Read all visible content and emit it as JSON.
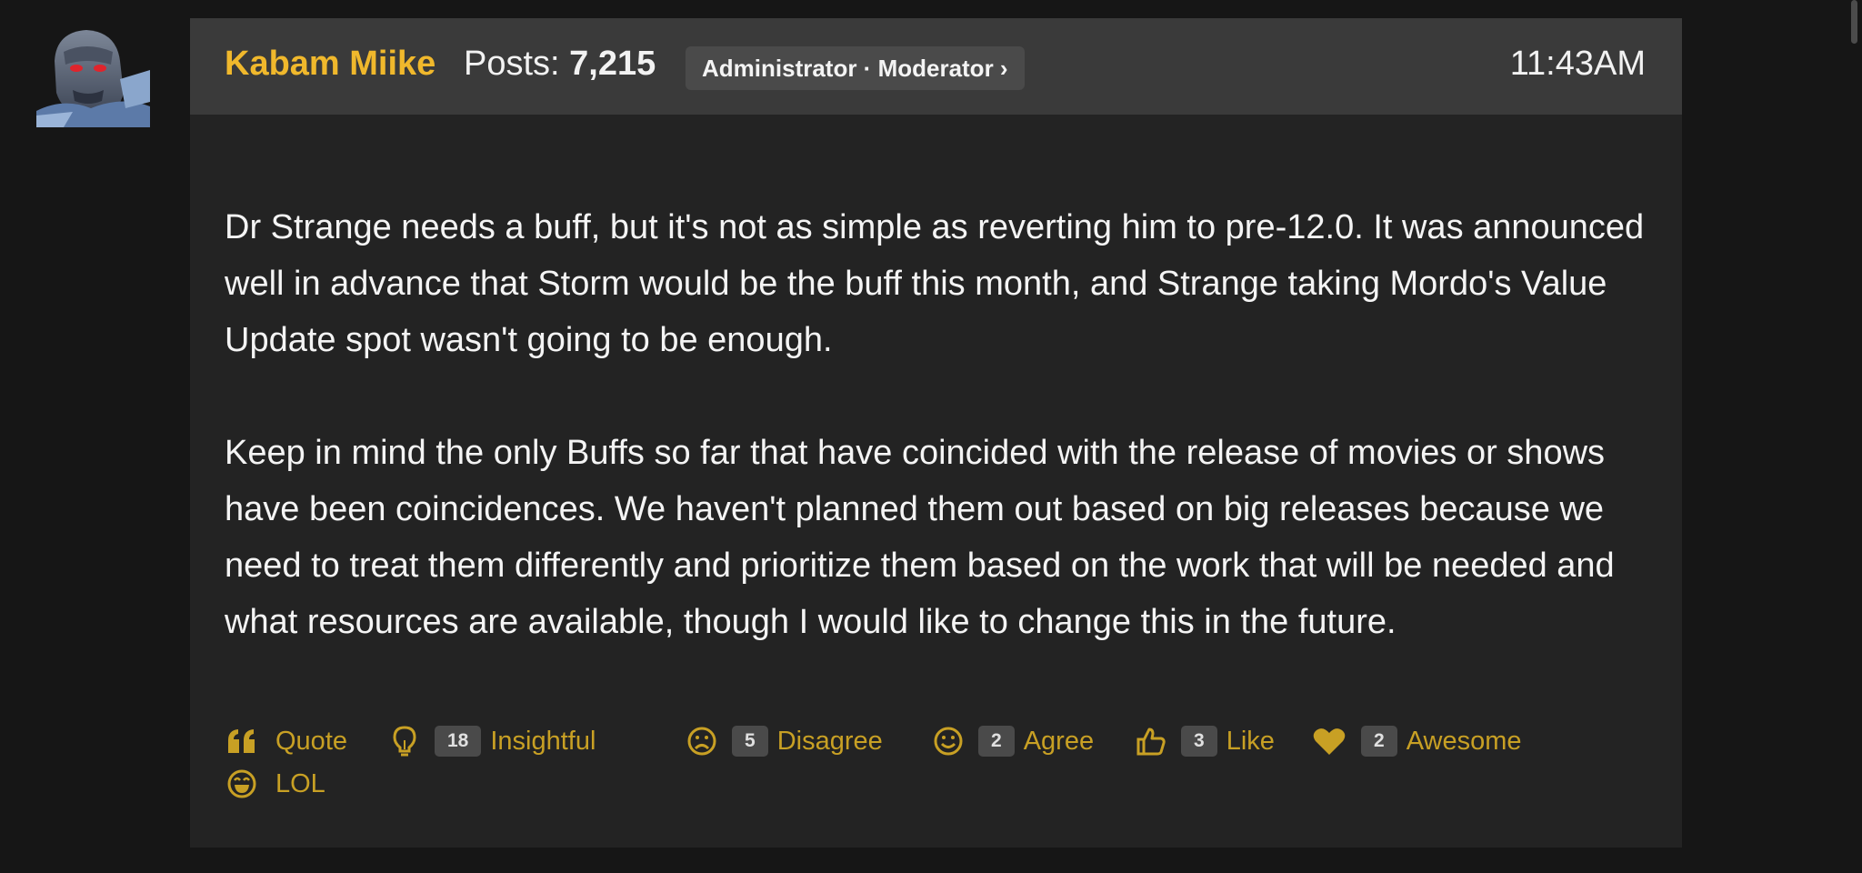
{
  "post": {
    "author": "Kabam Miike",
    "posts_label": "Posts: ",
    "posts_count": "7,215",
    "role": "Administrator · Moderator ›",
    "time": "11:43AM",
    "paragraphs": [
      "Dr Strange needs a buff, but it's not as simple as reverting him to pre-12.0. It was announced well in advance that Storm would be the buff this month, and Strange taking Mordo's Value Update spot wasn't going to be enough.",
      "Keep in mind the only Buffs so far that have coincided with the release of movies or shows have been coincidences. We haven't planned them out based on big releases because we need to treat them differently and prioritize them based on the work that will be needed and what resources are available, though I would like to change this in the future."
    ]
  },
  "reactions": [
    {
      "icon": "quote-icon",
      "label": "Quote",
      "count": ""
    },
    {
      "icon": "lightbulb-icon",
      "label": "Insightful",
      "count": "18"
    },
    {
      "icon": "frown-face-icon",
      "label": "Disagree",
      "count": "5"
    },
    {
      "icon": "smile-face-icon",
      "label": "Agree",
      "count": "2"
    },
    {
      "icon": "thumbs-up-icon",
      "label": "Like",
      "count": "3"
    },
    {
      "icon": "heart-icon",
      "label": "Awesome",
      "count": "2"
    },
    {
      "icon": "laughing-face-icon",
      "label": "LOL",
      "count": ""
    }
  ],
  "colors": {
    "background": "#161616",
    "post_background": "#232323",
    "header_background": "#3a3a3a",
    "author_name": "#f0b82c",
    "reaction_text": "#c8a024",
    "badge_background": "#4a4a4a"
  }
}
